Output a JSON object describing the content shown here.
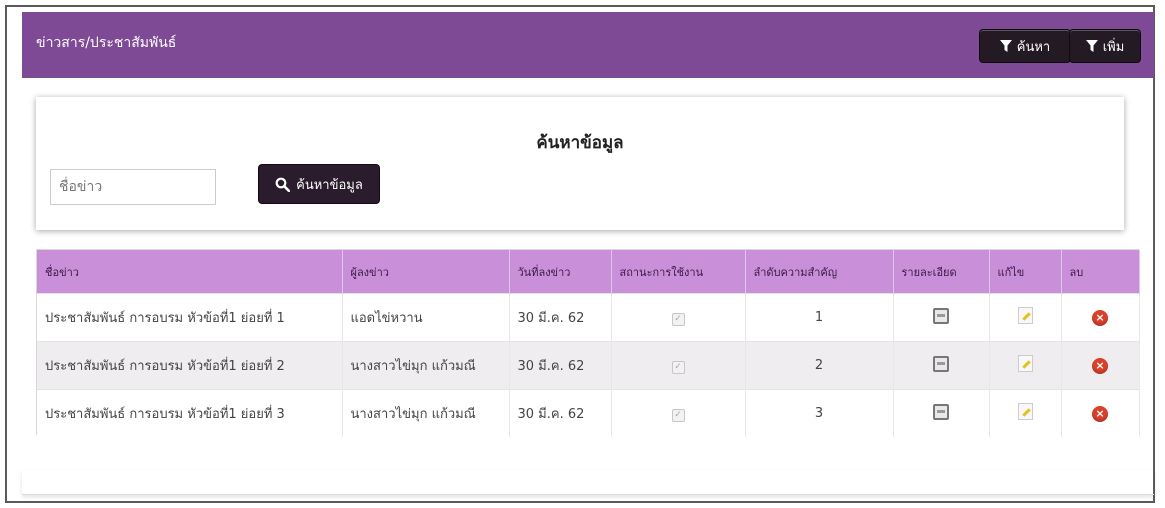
{
  "header": {
    "title": "ข่าวสาร/ประชาสัมพันธ์",
    "search_button": "ค้นหา",
    "add_button": "เพิ่ม"
  },
  "search": {
    "title": "ค้นหาข้อมูล",
    "placeholder": "ชื่อข่าว",
    "button_label": "ค้นหาข้อมูล"
  },
  "table": {
    "columns": [
      "ชื่อข่าว",
      "ผู้ลงข่าว",
      "วันที่ลงข่าว",
      "สถานะการใช้งาน",
      "ลำดับความสำคัญ",
      "รายละเอียด",
      "แก้ไข",
      "ลบ"
    ],
    "rows": [
      {
        "title": "ประชาสัมพันธ์ การอบรม หัวข้อที่1 ย่อยที่ 1",
        "author": "แอดไข่หวาน",
        "date": "30 มี.ค. 62",
        "active": true,
        "priority": "1"
      },
      {
        "title": "ประชาสัมพันธ์ การอบรม หัวข้อที่1 ย่อยที่ 2",
        "author": "นางสาวไข่มุก แก้วมณี",
        "date": "30 มี.ค. 62",
        "active": true,
        "priority": "2"
      },
      {
        "title": "ประชาสัมพันธ์ การอบรม หัวข้อที่1 ย่อยที่ 3",
        "author": "นางสาวไข่มุก แก้วมณี",
        "date": "30 มี.ค. 62",
        "active": true,
        "priority": "3"
      }
    ]
  },
  "icons": {
    "filter": "funnel-icon",
    "search": "magnifier-icon",
    "detail": "document-icon",
    "edit": "pencil-note-icon",
    "delete": "red-x-circle-icon"
  },
  "colors": {
    "header_bg": "#7e4a96",
    "table_header_bg": "#c98fd9",
    "button_bg": "#241a24",
    "delete": "#d9412b"
  }
}
